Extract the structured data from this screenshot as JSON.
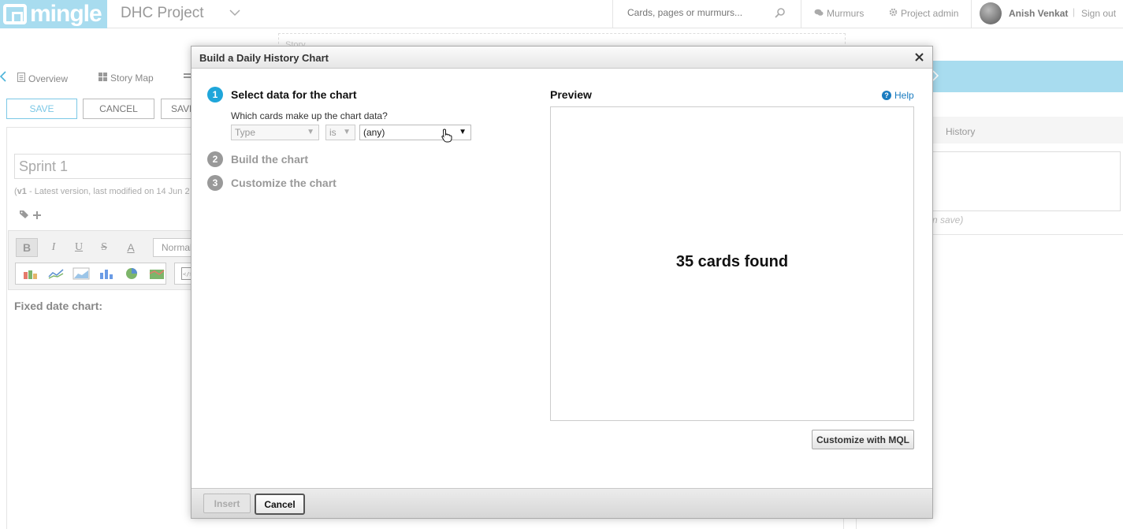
{
  "topbar": {
    "logo_text": "mingle",
    "project_name": "DHC Project",
    "search_placeholder": "Cards, pages or murmurs...",
    "murmurs_label": "Murmurs",
    "project_admin_label": "Project admin",
    "user_name": "Anish Venkat",
    "sign_out_label": "Sign out"
  },
  "page": {
    "story_label": "Story",
    "nav": [
      {
        "label": "Overview",
        "icon": "page-icon"
      },
      {
        "label": "Story Map",
        "icon": "grid-icon"
      }
    ],
    "save_label": "SAVE",
    "cancel_label": "CANCEL",
    "save_plus_label": "SAVE",
    "card_title": "Sprint 1",
    "version_prefix": "v1",
    "version_text": " - Latest version, last modified on 14 Jun 2",
    "format_normal": "Normal",
    "fixed_date_heading": "Fixed date chart:",
    "history_tab": "History",
    "on_save_note": "n save)"
  },
  "modal": {
    "title": "Build a Daily History Chart",
    "steps": [
      {
        "num": "1",
        "label": "Select data for the chart",
        "active": true
      },
      {
        "num": "2",
        "label": "Build the chart",
        "active": false
      },
      {
        "num": "3",
        "label": "Customize the chart",
        "active": false
      }
    ],
    "question": "Which cards make up the chart data?",
    "filter": {
      "property": "Type",
      "operator": "is",
      "value": "(any)"
    },
    "preview_title": "Preview",
    "help_label": "Help",
    "cards_found": "35 cards found",
    "customize_mql_label": "Customize with MQL",
    "insert_label": "Insert",
    "cancel_label": "Cancel"
  },
  "colors": {
    "brand": "#a8dcef",
    "step_active": "#1fa6da",
    "link": "#1a7cc0"
  }
}
